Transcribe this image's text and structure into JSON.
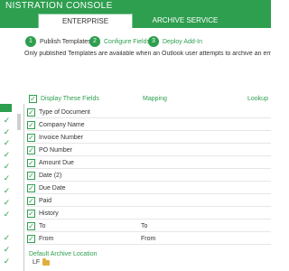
{
  "header": {
    "title": "NISTRATION CONSOLE"
  },
  "tabs": [
    {
      "label": "ENTERPRISE",
      "active": true
    },
    {
      "label": "ARCHIVE SERVICE",
      "active": false
    }
  ],
  "steps": [
    {
      "number": "1",
      "label": "Publish Templates",
      "current": true
    },
    {
      "number": "2",
      "label": "Configure Fields",
      "current": false
    },
    {
      "number": "3",
      "label": "Deploy Add-In",
      "current": false
    }
  ],
  "notice": "Only published Templates are available when an Outlook user attempts to archive an email to Laserfich",
  "field_table": {
    "headers": {
      "display": "Display These Fields",
      "mapping": "Mapping",
      "lookup": "Lookup"
    },
    "rows": [
      {
        "name": "Type of Document",
        "mapping": ""
      },
      {
        "name": "Company Name",
        "mapping": ""
      },
      {
        "name": "Invoice Number",
        "mapping": ""
      },
      {
        "name": "PO Number",
        "mapping": ""
      },
      {
        "name": "Amount Due",
        "mapping": ""
      },
      {
        "name": "Date (2)",
        "mapping": ""
      },
      {
        "name": "Due Date",
        "mapping": ""
      },
      {
        "name": "Paid",
        "mapping": ""
      },
      {
        "name": "History",
        "mapping": ""
      },
      {
        "name": "To",
        "mapping": "To"
      },
      {
        "name": "From",
        "mapping": "From"
      }
    ]
  },
  "default_location": {
    "label": "Default Archive Location",
    "value": "LF"
  },
  "colors": {
    "brand": "#2e9e4f",
    "text": "#333333"
  },
  "icons": {
    "check": "check-icon",
    "folder": "folder-icon"
  }
}
